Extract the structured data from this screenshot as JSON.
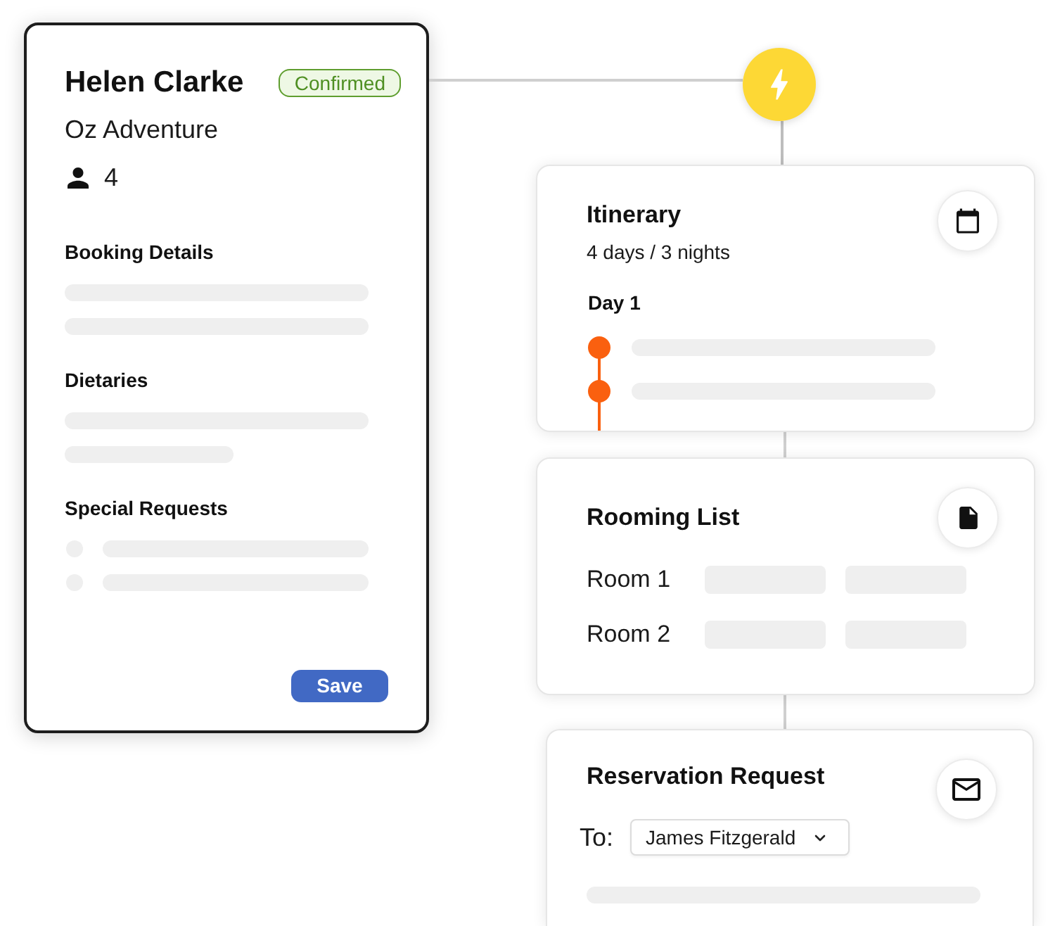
{
  "booking": {
    "guest_name": "Helen Clarke",
    "status": "Confirmed",
    "tour": "Oz Adventure",
    "party_size": "4",
    "sections": [
      {
        "title": "Booking Details",
        "placeholders": [
          {
            "kind": "line"
          },
          {
            "kind": "line"
          }
        ]
      },
      {
        "title": "Dietaries",
        "placeholders": [
          {
            "kind": "line"
          },
          {
            "kind": "short_line"
          }
        ]
      },
      {
        "title": "Special Requests",
        "placeholders": [
          {
            "kind": "bullet_line"
          },
          {
            "kind": "bullet_line"
          }
        ]
      }
    ],
    "save_button": "Save"
  },
  "steps": [
    {
      "kind": "itinerary",
      "title": "Itinerary",
      "subtitle": "4 days / 3 nights",
      "day_label": "Day 1",
      "stops": [
        {
          "kind": "stop"
        },
        {
          "kind": "stop"
        }
      ]
    },
    {
      "kind": "rooming_list",
      "title": "Rooming List",
      "rooms": [
        {
          "label": "Room 1"
        },
        {
          "label": "Room 2"
        }
      ]
    },
    {
      "kind": "reservation_request",
      "title": "Reservation Request",
      "to_label": "To:",
      "recipient": "James Fitzgerald"
    }
  ]
}
